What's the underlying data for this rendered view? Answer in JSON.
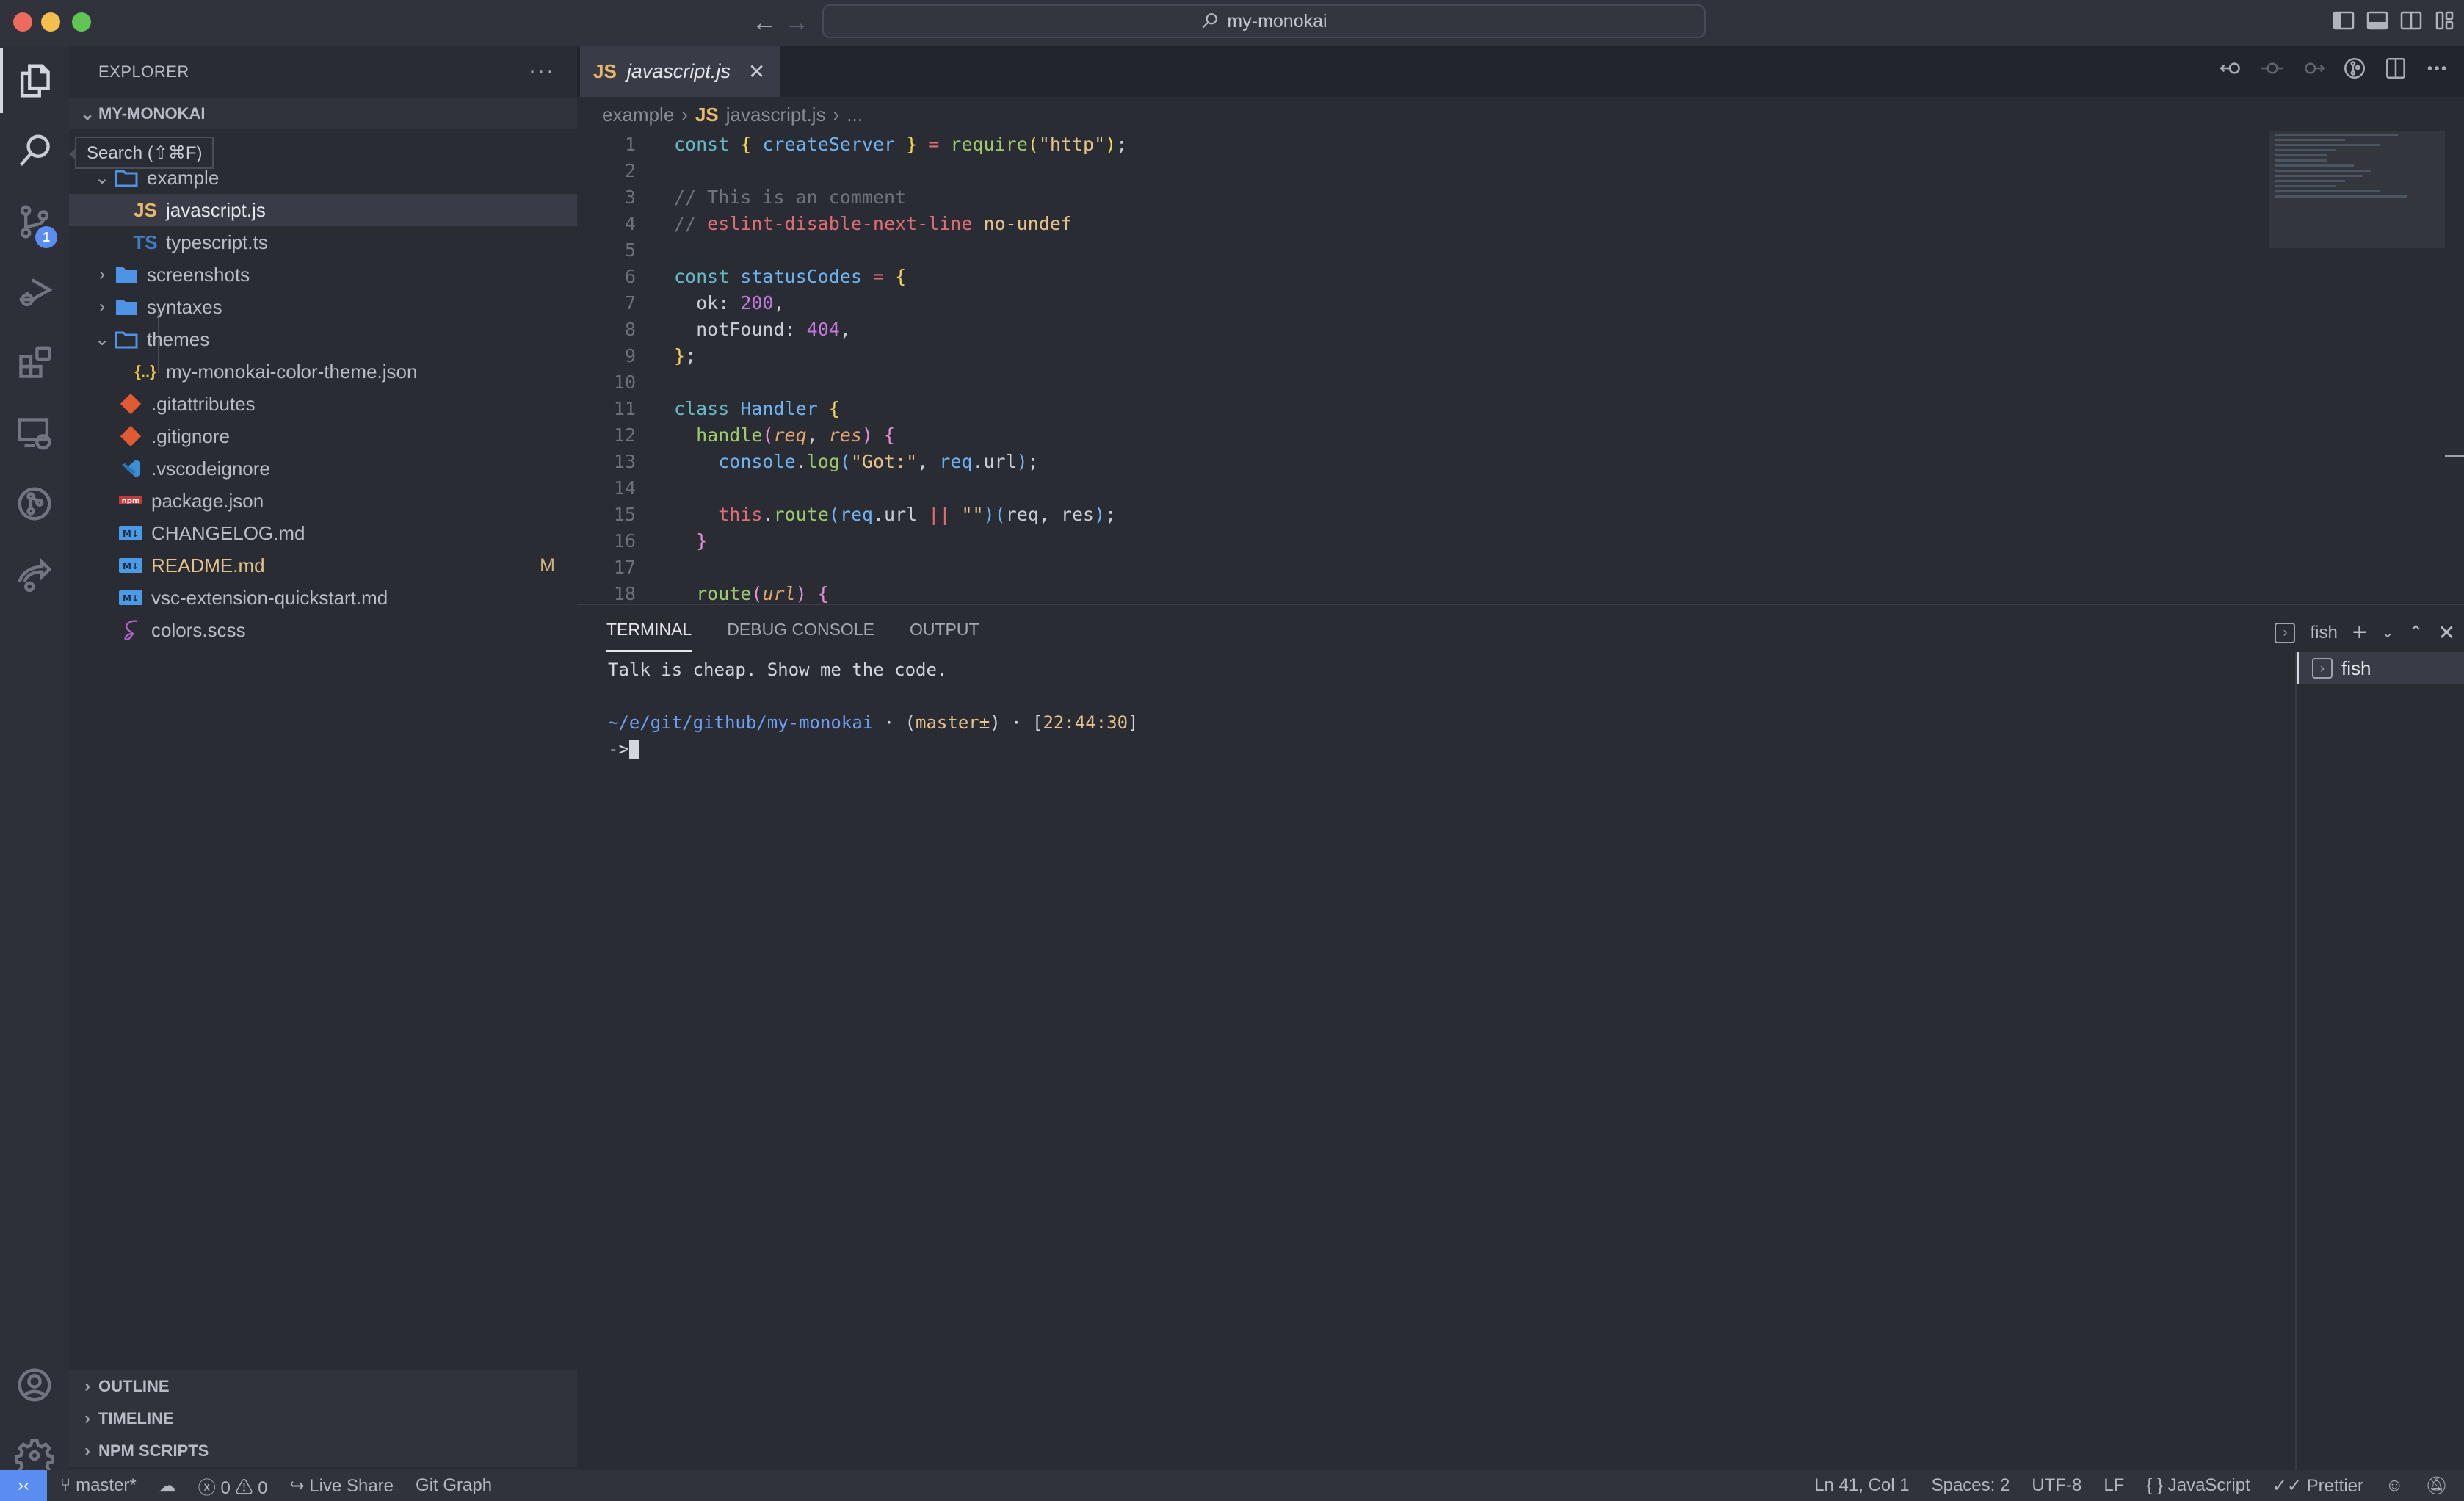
{
  "titlebar": {
    "command_center": "my-monokai",
    "back_icon": "arrow-left-icon",
    "forward_icon": "arrow-right-icon"
  },
  "activity_bar": {
    "items": [
      {
        "name": "explorer",
        "icon": "files-icon",
        "active": true
      },
      {
        "name": "search",
        "icon": "search-icon"
      },
      {
        "name": "source-control",
        "icon": "source-control-icon",
        "badge": "1"
      },
      {
        "name": "run-debug",
        "icon": "debug-icon"
      },
      {
        "name": "extensions",
        "icon": "extensions-icon"
      },
      {
        "name": "remote-explorer",
        "icon": "remote-explorer-icon"
      },
      {
        "name": "git-graph",
        "icon": "git-graph-icon"
      },
      {
        "name": "live-share",
        "icon": "live-share-icon"
      }
    ],
    "bottom": [
      {
        "name": "accounts",
        "icon": "account-icon"
      },
      {
        "name": "manage",
        "icon": "gear-icon"
      }
    ],
    "tooltip": "Search (⇧⌘F)"
  },
  "sidebar": {
    "title": "EXPLORER",
    "more": "···",
    "root": "MY-MONOKAI",
    "tree": [
      {
        "label": "example",
        "type": "folder-open",
        "depth": 1
      },
      {
        "label": "javascript.js",
        "type": "js",
        "depth": 2,
        "selected": true
      },
      {
        "label": "typescript.ts",
        "type": "ts",
        "depth": 2
      },
      {
        "label": "screenshots",
        "type": "folder",
        "depth": 1
      },
      {
        "label": "syntaxes",
        "type": "folder",
        "depth": 1
      },
      {
        "label": "themes",
        "type": "folder-open",
        "depth": 1
      },
      {
        "label": "my-monokai-color-theme.json",
        "type": "json",
        "depth": 2
      },
      {
        "label": ".gitattributes",
        "type": "git",
        "depth": 1
      },
      {
        "label": ".gitignore",
        "type": "git",
        "depth": 1
      },
      {
        "label": ".vscodeignore",
        "type": "vscode",
        "depth": 1
      },
      {
        "label": "package.json",
        "type": "npm",
        "depth": 1
      },
      {
        "label": "CHANGELOG.md",
        "type": "md",
        "depth": 1
      },
      {
        "label": "README.md",
        "type": "md",
        "depth": 1,
        "status": "M"
      },
      {
        "label": "vsc-extension-quickstart.md",
        "type": "md",
        "depth": 1
      },
      {
        "label": "colors.scss",
        "type": "scss",
        "depth": 1
      }
    ],
    "sections": [
      "OUTLINE",
      "TIMELINE",
      "NPM SCRIPTS"
    ]
  },
  "editor": {
    "tab": {
      "icon": "JS",
      "label": "javascript.js"
    },
    "breadcrumb": {
      "folder": "example",
      "icon": "JS",
      "file": "javascript.js",
      "more": "..."
    },
    "lines": [
      "1",
      "2",
      "3",
      "4",
      "5",
      "6",
      "7",
      "8",
      "9",
      "10",
      "11",
      "12",
      "13",
      "14",
      "15",
      "16",
      "17",
      "18"
    ],
    "code_text": {
      "l1": [
        "const",
        "{",
        "createServer",
        "}",
        "=",
        "require",
        "(",
        "\"http\"",
        ")",
        ";"
      ],
      "l3": "// This is an comment",
      "l4": [
        "// ",
        "eslint-disable-next-line",
        "no-undef"
      ],
      "l6": [
        "const",
        "statusCodes",
        "=",
        "{"
      ],
      "l7": [
        "ok",
        "200"
      ],
      "l8": [
        "notFound",
        "404"
      ],
      "l9": [
        "}",
        ";"
      ],
      "l11": [
        "class",
        "Handler",
        "{"
      ],
      "l12": [
        "handle",
        "req",
        "res"
      ],
      "l13": [
        "console",
        "log",
        "\"Got:\"",
        "req",
        "url"
      ],
      "l15": [
        "this",
        "route",
        "req",
        "url",
        "||",
        "\"\"",
        "req",
        "res"
      ],
      "l16": "}",
      "l18": [
        "route",
        "url"
      ]
    }
  },
  "panel": {
    "tabs": [
      "TERMINAL",
      "DEBUG CONSOLE",
      "OUTPUT"
    ],
    "active_tab": "TERMINAL",
    "terminal_name": "fish",
    "terminal": {
      "line1": "Talk is cheap. Show me the code.",
      "path": "~/e/git/github/my-monokai",
      "branch": "master±",
      "time": "22:44:30",
      "prompt": "->"
    },
    "terminal_list": [
      "fish"
    ]
  },
  "statusbar": {
    "branch": "master*",
    "errors": "0",
    "warnings": "0",
    "live_share": "Live Share",
    "git_graph": "Git Graph",
    "position": "Ln 41, Col 1",
    "spaces": "Spaces: 2",
    "encoding": "UTF-8",
    "eol": "LF",
    "language": "JavaScript",
    "formatter": "Prettier"
  },
  "colors": {
    "accent": "#5b8cf0",
    "js_icon": "#e6b96a",
    "modified": "#e3c28b"
  }
}
